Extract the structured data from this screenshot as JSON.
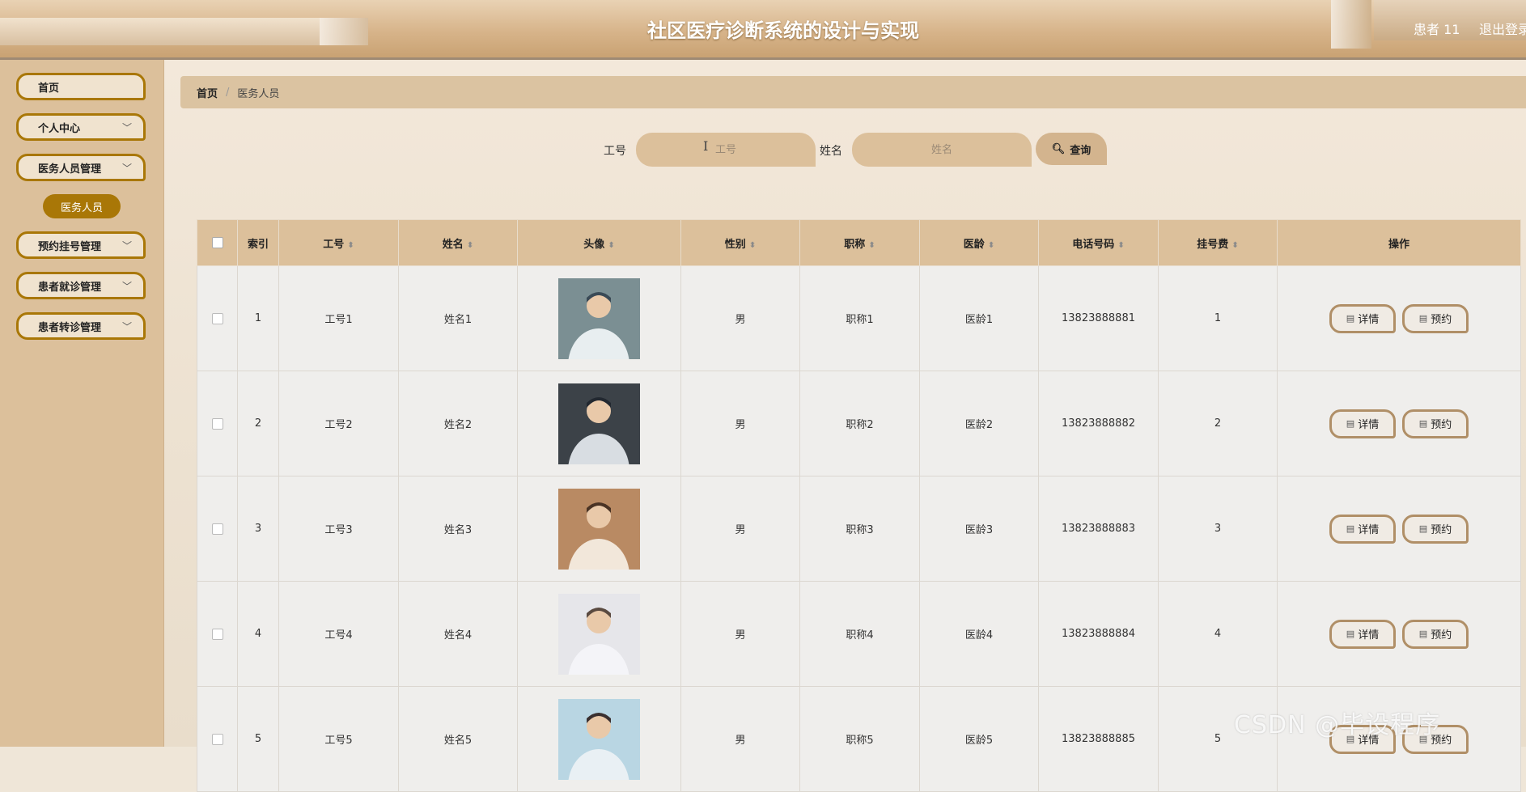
{
  "header": {
    "title": "社区医疗诊断系统的设计与实现",
    "user_name": "患者 11",
    "logout": "退出登录"
  },
  "sidebar": {
    "items": [
      {
        "label": "首页",
        "has_submenu": false
      },
      {
        "label": "个人中心",
        "has_submenu": true
      },
      {
        "label": "医务人员管理",
        "has_submenu": true
      },
      {
        "label": "预约挂号管理",
        "has_submenu": true
      },
      {
        "label": "患者就诊管理",
        "has_submenu": true
      },
      {
        "label": "患者转诊管理",
        "has_submenu": true
      }
    ],
    "active_sub": "医务人员"
  },
  "breadcrumb": {
    "home": "首页",
    "separator": "/",
    "current": "医务人员"
  },
  "search": {
    "job_label": "工号",
    "job_placeholder": "工号",
    "name_label": "姓名",
    "name_placeholder": "姓名",
    "query_label": "查询",
    "query_icon": "search-icon"
  },
  "table": {
    "headers": {
      "index": "索引",
      "job_no": "工号",
      "name": "姓名",
      "avatar": "头像",
      "gender": "性别",
      "title": "职称",
      "seniority": "医龄",
      "phone": "电话号码",
      "fee": "挂号费",
      "actions": "操作"
    },
    "detail_label": "详情",
    "book_label": "预约",
    "rows": [
      {
        "index": "1",
        "job_no": "工号1",
        "name": "姓名1",
        "gender": "男",
        "title": "职称1",
        "seniority": "医龄1",
        "phone": "13823888881",
        "fee": "1"
      },
      {
        "index": "2",
        "job_no": "工号2",
        "name": "姓名2",
        "gender": "男",
        "title": "职称2",
        "seniority": "医龄2",
        "phone": "13823888882",
        "fee": "2"
      },
      {
        "index": "3",
        "job_no": "工号3",
        "name": "姓名3",
        "gender": "男",
        "title": "职称3",
        "seniority": "医龄3",
        "phone": "13823888883",
        "fee": "3"
      },
      {
        "index": "4",
        "job_no": "工号4",
        "name": "姓名4",
        "gender": "男",
        "title": "职称4",
        "seniority": "医龄4",
        "phone": "13823888884",
        "fee": "4"
      },
      {
        "index": "5",
        "job_no": "工号5",
        "name": "姓名5",
        "gender": "男",
        "title": "职称5",
        "seniority": "医龄5",
        "phone": "13823888885",
        "fee": "5"
      }
    ]
  },
  "watermark": "CSDN @毕设程序",
  "colors": {
    "accent": "#a97707",
    "sidebar_bg": "#dcc09b",
    "header_bg": "#d7b48a",
    "button_border": "#b08f67"
  }
}
